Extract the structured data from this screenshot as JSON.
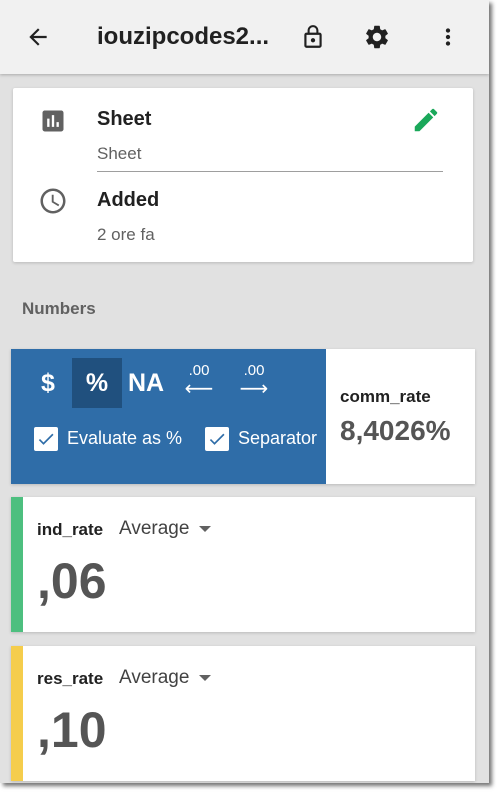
{
  "toolbar": {
    "title": "iouzipcodes2...",
    "icons": [
      "back-arrow-icon",
      "lock-icon",
      "settings-gear-icon",
      "more-vert-icon"
    ]
  },
  "info": {
    "sheet_label": "Sheet",
    "sheet_value": "Sheet",
    "added_label": "Added",
    "added_value": "2 ore fa",
    "accent_color": "#1aa85a"
  },
  "numbers": {
    "section_title": "Numbers",
    "format": {
      "currency_label": "$",
      "percent_label": "%",
      "na_label": "NA",
      "decrease_decimals_label": ".00",
      "increase_decimals_label": ".00",
      "evaluate_label": "Evaluate as %",
      "evaluate_checked": true,
      "separator_label": "Separator",
      "separator_checked": true,
      "active_format": "percent",
      "panel_color": "#2f6da8"
    },
    "comm_rate": {
      "name": "comm_rate",
      "value": "8,4026%"
    },
    "cards": [
      {
        "name": "ind_rate",
        "aggregate": "Average",
        "value": ",06",
        "color": "#4dbf7f"
      },
      {
        "name": "res_rate",
        "aggregate": "Average",
        "value": ",10",
        "color": "#f5cd4c"
      }
    ]
  }
}
